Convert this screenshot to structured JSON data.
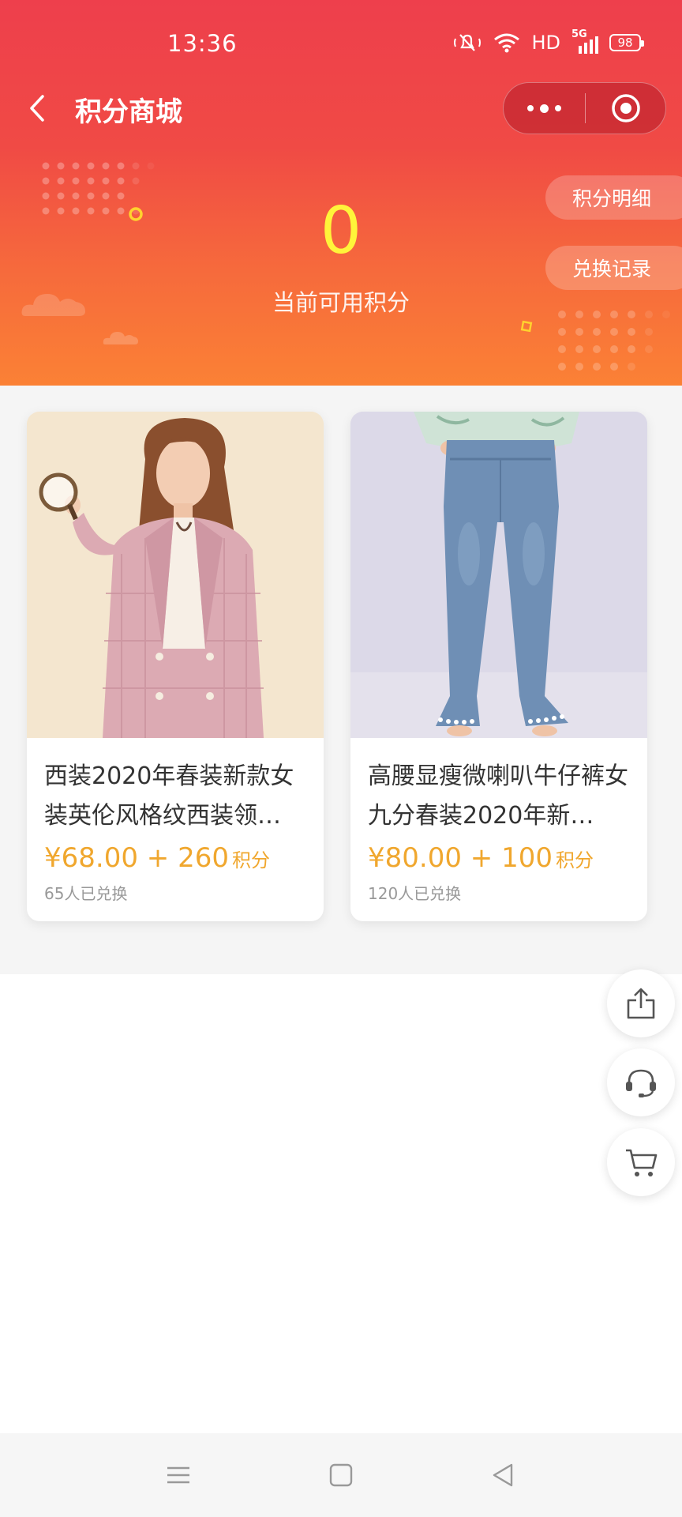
{
  "status_bar": {
    "time": "13:36",
    "network_label": "HD",
    "signal_label": "5G",
    "battery_level": "98"
  },
  "nav": {
    "title": "积分商城",
    "back_icon": "chevron-left-icon",
    "more_icon": "more-dots-icon",
    "close_icon": "target-circle-icon"
  },
  "header": {
    "points_value": "0",
    "points_label": "当前可用积分",
    "points_detail_label": "积分明细",
    "exchange_record_label": "兑换记录",
    "value_color": "#fff43a"
  },
  "products": [
    {
      "name": "西装2020年春装新款女装英伦风格纹西装领…",
      "price": "¥68.00 + 260",
      "points_unit": "积分",
      "sold": "65人已兑换"
    },
    {
      "name": "高腰显瘦微喇叭牛仔裤女九分春装2020年新…",
      "price": "¥80.00 + 100",
      "points_unit": "积分",
      "sold": "120人已兑换"
    }
  ],
  "float_buttons": [
    {
      "icon": "share-icon"
    },
    {
      "icon": "customer-service-headset-icon"
    },
    {
      "icon": "cart-icon"
    }
  ],
  "system_nav": [
    {
      "icon": "menu-icon"
    },
    {
      "icon": "home-square-icon"
    },
    {
      "icon": "back-triangle-icon"
    }
  ],
  "colors": {
    "header_top": "#ee3f4c",
    "header_bottom": "#fb8135",
    "price": "#f0a72e"
  }
}
